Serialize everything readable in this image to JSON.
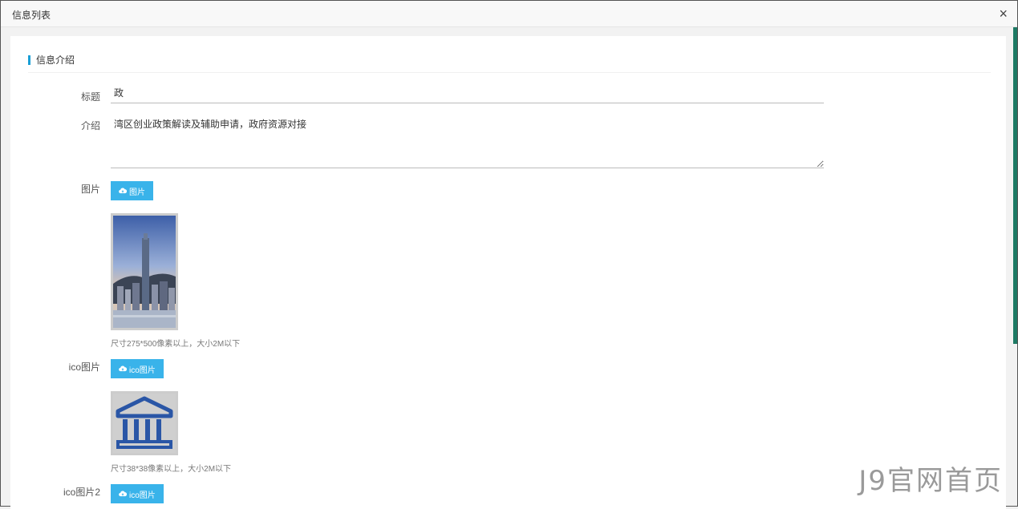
{
  "dialog": {
    "title": "信息列表",
    "close_glyph": "×"
  },
  "section": {
    "title": "信息介绍"
  },
  "form": {
    "title_label": "标题",
    "title_value": "政",
    "intro_label": "介绍",
    "intro_value": "湾区创业政策解读及辅助申请，政府资源对接",
    "image_label": "图片",
    "image_button": "图片",
    "image_hint": "尺寸275*500像素以上，大小2M以下",
    "ico_label": "ico图片",
    "ico_button": "ico图片",
    "ico_hint": "尺寸38*38像素以上，大小2M以下",
    "ico2_label": "ico图片2",
    "ico2_button": "ico图片"
  },
  "icons": {
    "upload": "cloud-upload-icon",
    "ico_preview": "bank-building-icon"
  },
  "colors": {
    "accent": "#39b3ea",
    "section_bar": "#1a9fd6",
    "scrollbar": "#1d7a64",
    "ico_blue": "#2a56a6"
  },
  "watermark": "J9官网首页"
}
